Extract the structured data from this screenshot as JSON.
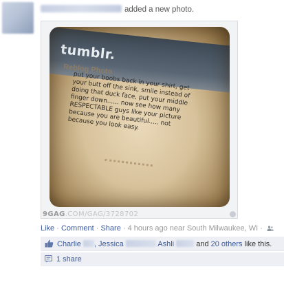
{
  "post": {
    "action_text": "added a new photo."
  },
  "photo": {
    "logo": "tumblr.",
    "subtitle": "Reblog Photo",
    "meme_lines": [
      "put your boobs back in your shirt, get",
      "your butt off the sink, smile instead of",
      "doing that duck face, put your middle",
      "finger down...... now see how many",
      "RESPECTABLE guys like your picture",
      "because you are beautiful..... not",
      "because you look easy."
    ],
    "watermark": "9GAG",
    "watermark_url": ".COM/GAG/3728702"
  },
  "actions": {
    "like": "Like",
    "comment": "Comment",
    "share": "Share",
    "time": "4 hours ago near South Milwaukee, WI",
    "sep": "·",
    "privacy_icon": "people-icon"
  },
  "likes": {
    "name1": "Charlie",
    "name2": ", Jessica",
    "name3": "Ashli",
    "and_text": "and",
    "others_link": "20 others",
    "suffix": "like this.",
    "icon": "thumbs-up-icon"
  },
  "shares": {
    "label": "1 share",
    "icon": "share-icon"
  },
  "colors": {
    "link": "#3b5998",
    "box_bg": "#edeff4"
  }
}
